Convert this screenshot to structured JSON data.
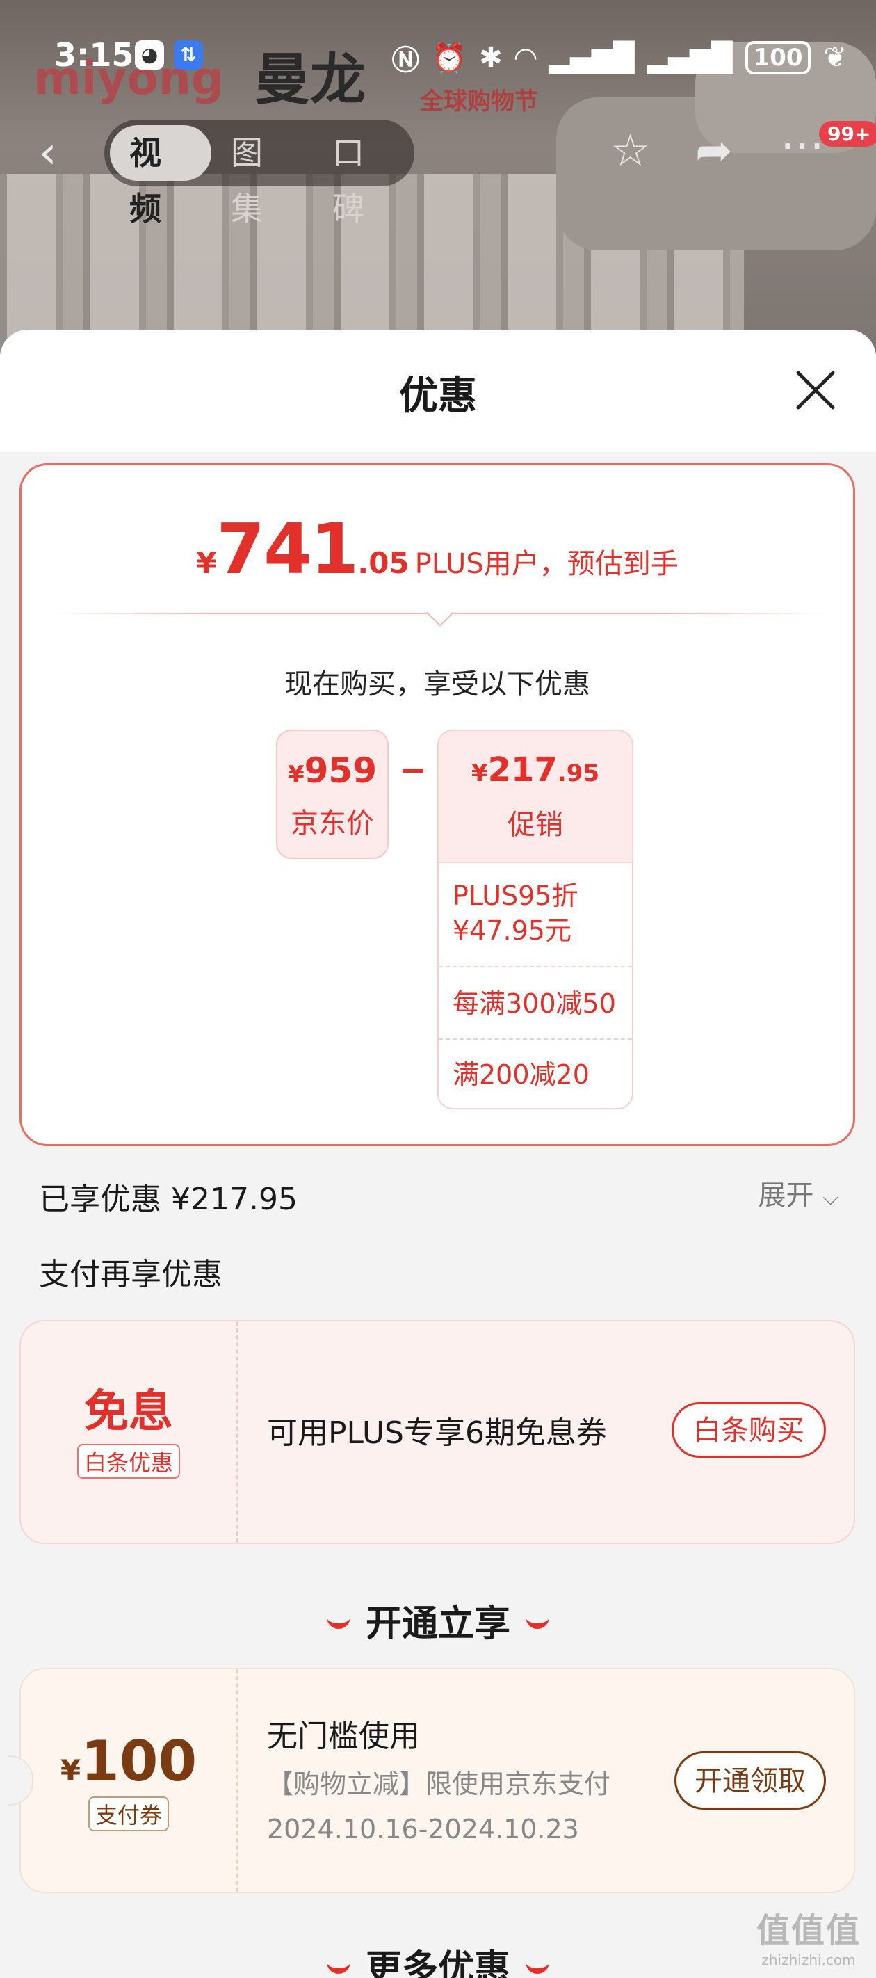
{
  "status_bar": {
    "time": "3:15",
    "battery": "100"
  },
  "background": {
    "brand_left": "miyong",
    "brand_cn": "曼龙",
    "brand_right": "全球购物节"
  },
  "nav": {
    "tabs": [
      "视频",
      "图集",
      "口碑"
    ],
    "active_tab": 0,
    "badge": "99+"
  },
  "sheet": {
    "title": "优惠"
  },
  "price_summary": {
    "currency": "¥",
    "final_int": "741",
    "final_dec": ".05",
    "final_note": "PLUS用户，预估到手",
    "subtitle": "现在购买，享受以下优惠",
    "jd_price": "959",
    "jd_label": "京东价",
    "promo_int": "217",
    "promo_dec": ".95",
    "promo_label": "促销",
    "promo_items": [
      "PLUS95折\n¥47.95元",
      "每满300减50",
      "满200减20"
    ]
  },
  "enjoyed": {
    "text": "已享优惠 ¥217.95",
    "expand_label": "展开"
  },
  "pay_more": {
    "title": "支付再享优惠",
    "left_big": "免息",
    "left_tag": "白条优惠",
    "text": "可用PLUS专享6期免息券",
    "button": "白条购买"
  },
  "open_section": {
    "title": "开通立享",
    "coupon_amount": "100",
    "coupon_tag": "支付券",
    "coupon_title": "无门槛使用",
    "coupon_desc": "【购物立减】限使用京东支付",
    "coupon_date": "2024.10.16-2024.10.23",
    "button": "开通领取"
  },
  "more_section": {
    "title": "更多优惠"
  },
  "watermark": {
    "line1": "值值值",
    "line2": "zhizhizhi.com"
  },
  "colors": {
    "accent_red": "#e2312a",
    "coupon_brown": "#7a3a12"
  }
}
